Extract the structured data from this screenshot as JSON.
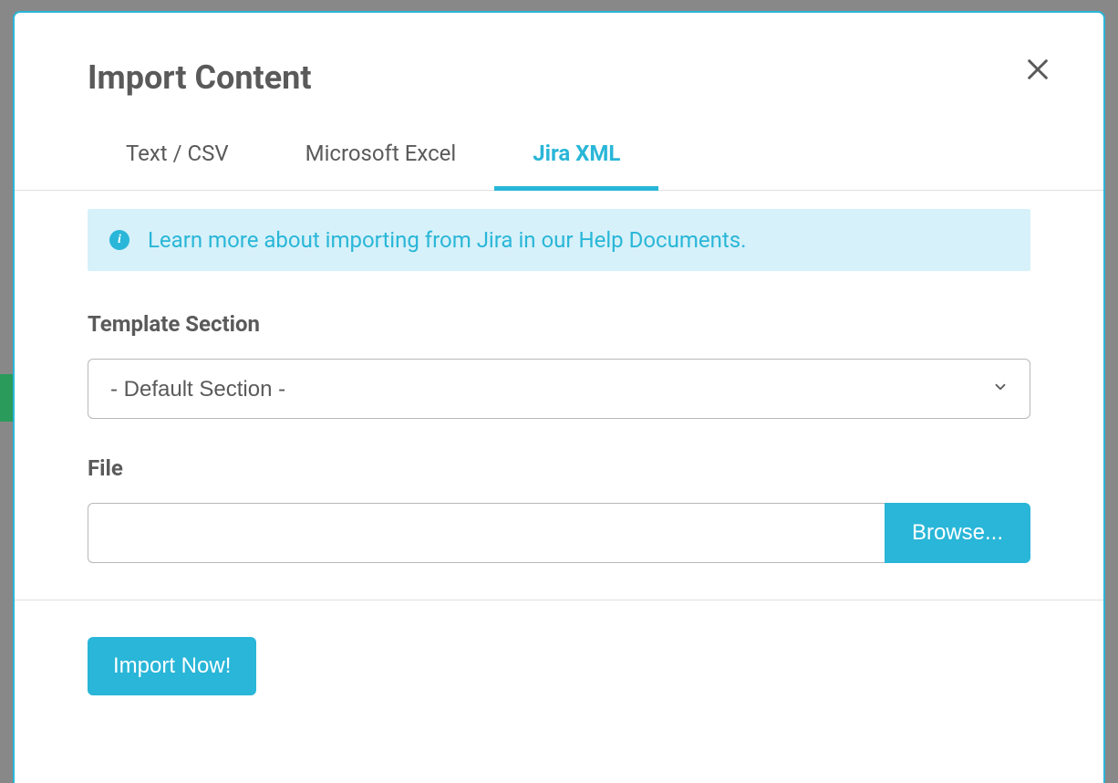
{
  "modal": {
    "title": "Import Content",
    "tabs": [
      {
        "label": "Text / CSV",
        "active": false
      },
      {
        "label": "Microsoft Excel",
        "active": false
      },
      {
        "label": "Jira XML",
        "active": true
      }
    ],
    "info_text": "Learn more about importing from Jira in our Help Documents.",
    "template_section": {
      "label": "Template Section",
      "selected": "- Default Section -"
    },
    "file": {
      "label": "File",
      "value": "",
      "browse_label": "Browse..."
    },
    "import_button": "Import Now!"
  },
  "colors": {
    "accent": "#29b6d8",
    "info_bg": "#d6f1f9",
    "text": "#5a5a5a"
  }
}
